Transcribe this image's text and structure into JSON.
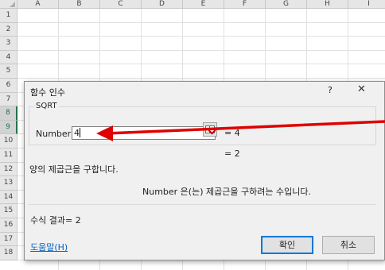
{
  "columns": [
    "A",
    "B",
    "C",
    "D",
    "E",
    "F",
    "G",
    "H",
    "I"
  ],
  "rows": [
    "1",
    "2",
    "3",
    "4",
    "5",
    "6",
    "7",
    "8",
    "9",
    "10",
    "11",
    "12",
    "13",
    "14",
    "15",
    "16",
    "17",
    "18"
  ],
  "selected_rows": [
    "8",
    "9"
  ],
  "dialog": {
    "title": "함수 인수",
    "help_button": "?",
    "close_button": "✕",
    "function_name": "SQRT",
    "arg_label": "Number",
    "arg_value": "4",
    "arg_result": "=  4",
    "function_result": "=  2",
    "description": "양의 제곱근을 구합니다.",
    "arg_description": "Number  은(는) 제곱근을 구하려는 수입니다.",
    "formula_result": "수식 결과=  2",
    "help_link": "도움말(H)",
    "ok_label": "확인",
    "cancel_label": "취소"
  },
  "colors": {
    "accent": "#0078d7",
    "arrow": "#e00000",
    "excel_green": "#217346"
  }
}
